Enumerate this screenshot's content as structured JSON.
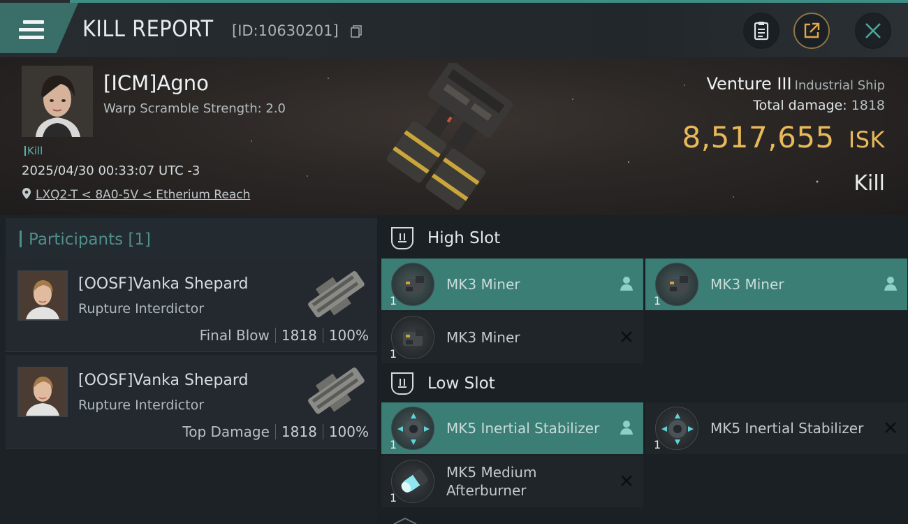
{
  "header": {
    "title": "KILL REPORT",
    "report_id": "[ID:10630201]"
  },
  "victim": {
    "name": "[ICM]Agno",
    "warp_scramble": "Warp Scramble Strength: 2.0",
    "kill_tag": "Kill",
    "timestamp": "2025/04/30 00:33:07 UTC -3",
    "location": "LXQ2-T < 8A0-5V < Etherium Reach",
    "ship_name": "Venture III",
    "ship_class": "Industrial Ship",
    "total_damage_label": "Total damage:",
    "total_damage": "1818",
    "isk_value": "8,517,655",
    "isk_unit": "ISK",
    "outcome": "Kill"
  },
  "participants": {
    "title": "Participants",
    "count": "[1]",
    "items": [
      {
        "name": "[OOSF]Vanka Shepard",
        "ship": "Rupture Interdictor",
        "label": "Final Blow",
        "damage": "1818",
        "percent": "100%"
      },
      {
        "name": "[OOSF]Vanka Shepard",
        "ship": "Rupture Interdictor",
        "label": "Top Damage",
        "damage": "1818",
        "percent": "100%"
      }
    ]
  },
  "slots": {
    "high": {
      "label": "High Slot",
      "modules": [
        {
          "name": "MK3 Miner",
          "qty": "1",
          "status": "dropped"
        },
        {
          "name": "MK3 Miner",
          "qty": "1",
          "status": "dropped"
        },
        {
          "name": "MK3 Miner",
          "qty": "1",
          "status": "destroyed"
        }
      ]
    },
    "low": {
      "label": "Low Slot",
      "modules": [
        {
          "name": "MK5 Inertial Stabilizer",
          "qty": "1",
          "status": "dropped"
        },
        {
          "name": "MK5 Inertial Stabilizer",
          "qty": "1",
          "status": "destroyed"
        },
        {
          "name": "MK5 Medium Afterburner",
          "qty": "1",
          "status": "destroyed"
        }
      ]
    }
  },
  "colors": {
    "accent": "#3b7e76",
    "isk": "#e8b95a",
    "panel": "#1f2529"
  }
}
